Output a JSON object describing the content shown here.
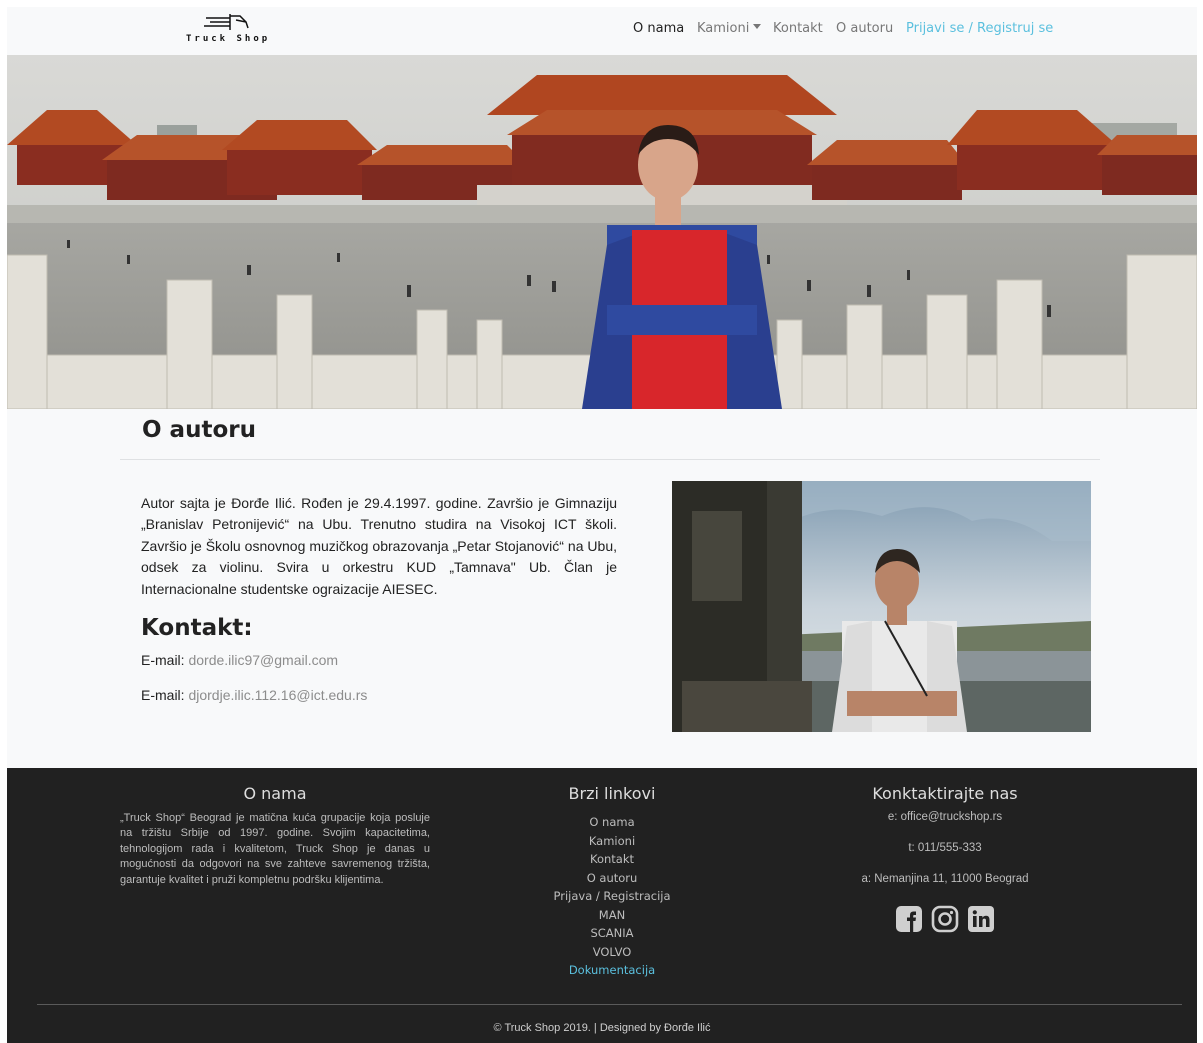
{
  "brand": {
    "name": "Truck Shop"
  },
  "nav": {
    "items": [
      {
        "label": "O nama"
      },
      {
        "label": "Kamioni"
      },
      {
        "label": "Kontakt"
      },
      {
        "label": "O autoru"
      },
      {
        "label": "Prijavi se / Registruj se"
      }
    ]
  },
  "about": {
    "title": "O autoru",
    "bio": "Autor sajta je Đorđe Ilić. Rođen je 29.4.1997. godine. Završio je Gimnaziju „Branislav Petronijević“ na Ubu. Trenutno studira na Visokoj ICT školi. Završio je Školu osnovnog muzičkog obrazovanja „Petar Stojanović“ na Ubu, odsek za violinu. Svira u orkestru KUD „Tamnava\" Ub. Član je Internacionalne studentske ograizacije AIESEC."
  },
  "contact": {
    "title": "Kontakt:",
    "rows": [
      {
        "label": "E-mail:",
        "value": "dorde.ilic97@gmail.com"
      },
      {
        "label": "E-mail:",
        "value": "djordje.ilic.112.16@ict.edu.rs"
      }
    ]
  },
  "footer": {
    "about": {
      "title": "O nama",
      "text": "„Truck Shop“ Beograd je matična kuća grupacije koja posluje na tržištu Srbije od 1997. godine. Svojim kapacitetima, tehnologijom rada i kvalitetom, Truck Shop je danas u mogućnosti da odgovori na sve zahteve savremenog tržišta, garantuje kvalitet i pruži kompletnu podršku klijentima."
    },
    "links": {
      "title": "Brzi linkovi",
      "items": [
        "O nama",
        "Kamioni",
        "Kontakt",
        "O autoru",
        "Prijava / Registracija",
        "MAN",
        "SCANIA",
        "VOLVO",
        "Dokumentacija"
      ]
    },
    "contact": {
      "title": "Konktaktirajte nas",
      "email": "e: office@truckshop.rs",
      "phone": "t: 011/555-333",
      "address": "a: Nemanjina 11, 11000 Beograd"
    },
    "social": [
      "facebook-icon",
      "instagram-icon",
      "linkedin-icon"
    ],
    "copyright": "© Truck Shop 2019. | Designed by Đorđe Ilić"
  },
  "colors": {
    "accent": "#5bc0de",
    "footer_bg": "#212121",
    "page_bg": "#f8f9fa"
  }
}
